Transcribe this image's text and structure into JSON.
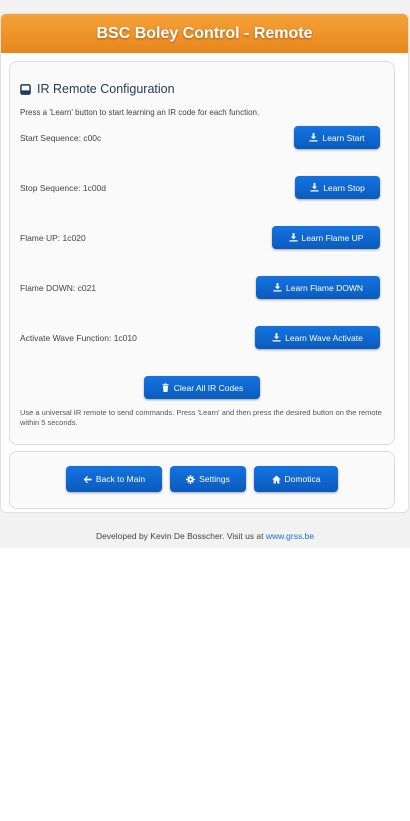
{
  "header": {
    "title": "BSC Boley Control - Remote"
  },
  "ir_card": {
    "icon": "remote-icon",
    "title": "IR Remote Configuration",
    "intro": "Press a 'Learn' button to start learning an IR code for each function.",
    "rows": [
      {
        "label": "Start Sequence: c00c",
        "button": "Learn Start",
        "icon": "download-icon"
      },
      {
        "label": "Stop Sequence: 1c00d",
        "button": "Learn Stop",
        "icon": "download-icon"
      },
      {
        "label": "Flame UP: 1c020",
        "button": "Learn Flame UP",
        "icon": "download-icon"
      },
      {
        "label": "Flame DOWN: c021",
        "button": "Learn Flame DOWN",
        "icon": "download-icon"
      },
      {
        "label": "Activate Wave Function: 1c010",
        "button": "Learn Wave Activate",
        "icon": "download-icon"
      }
    ],
    "clear_button": "Clear All IR Codes",
    "hint": "Use a universal IR remote to send commands. Press 'Learn' and then press the desired button on the remote within 5 seconds."
  },
  "nav": {
    "back": "Back to Main",
    "settings": "Settings",
    "domotica": "Domotica"
  },
  "footer": {
    "text": "Developed by Kevin De Bosscher. Visit us at ",
    "link": "www.grss.be"
  },
  "colors": {
    "header": "#ef9328",
    "button": "#0d63c9",
    "link": "#1473e0"
  }
}
